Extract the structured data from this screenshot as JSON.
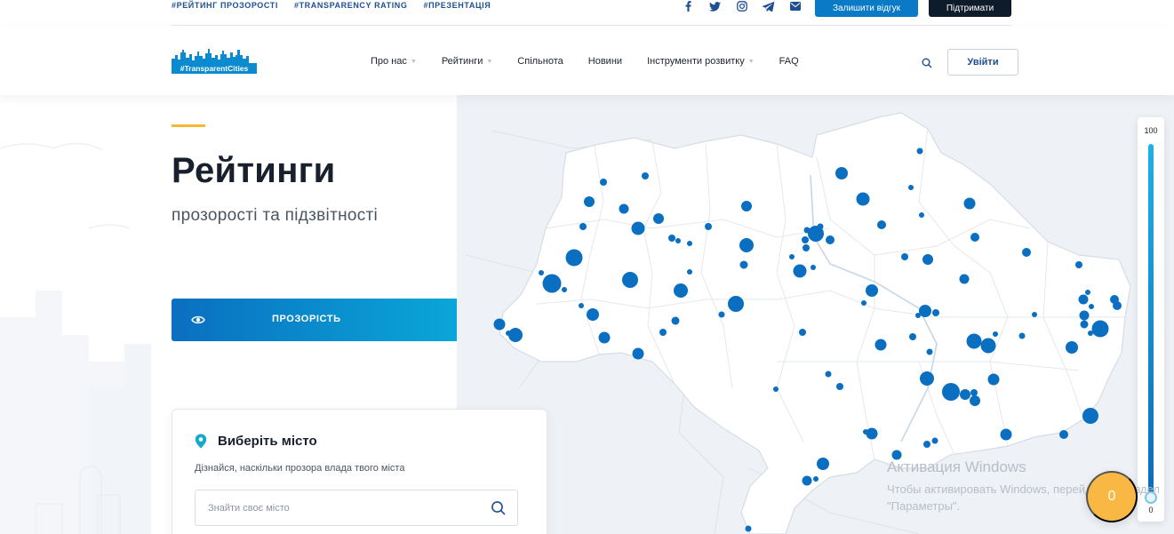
{
  "top_links": [
    "#Рейтинг прозорості",
    "#Transparency rating",
    "#Презентація"
  ],
  "social_icons": [
    "facebook-icon",
    "twitter-icon",
    "instagram-icon",
    "telegram-icon",
    "mail-icon"
  ],
  "top_buttons": {
    "feedback": "Залишити відгук",
    "support": "Підтримати"
  },
  "logo": {
    "text": "#TransparentCities",
    "color": "#0a8bcf"
  },
  "nav": {
    "items": [
      {
        "label": "Про нас",
        "has_dropdown": true
      },
      {
        "label": "Рейтинги",
        "has_dropdown": true
      },
      {
        "label": "Спільнота",
        "has_dropdown": false
      },
      {
        "label": "Новини",
        "has_dropdown": false
      },
      {
        "label": "Інструменти розвитку",
        "has_dropdown": true
      },
      {
        "label": "FAQ",
        "has_dropdown": false
      }
    ],
    "login": "Увійти"
  },
  "hero": {
    "title": "Рейтинги",
    "subtitle": "прозорості та підзвітності",
    "active_tab": "Прозорість"
  },
  "city_card": {
    "heading": "Виберіть місто",
    "description": "Дізнайся, наскільки прозора влада твого міста",
    "search_placeholder": "Знайти своє місто"
  },
  "slider": {
    "max_label": "100",
    "min_label": "0",
    "value": 0
  },
  "fab_label": "0",
  "watermark": {
    "title": "Активация Windows",
    "text": "Чтобы активировать Windows, перейдите в раздел \"Параметры\"."
  },
  "colors": {
    "accent": "#f7b733",
    "primary": "#0a7ac7",
    "dark": "#0d1b2a",
    "marker": "#0a6fc0"
  }
}
